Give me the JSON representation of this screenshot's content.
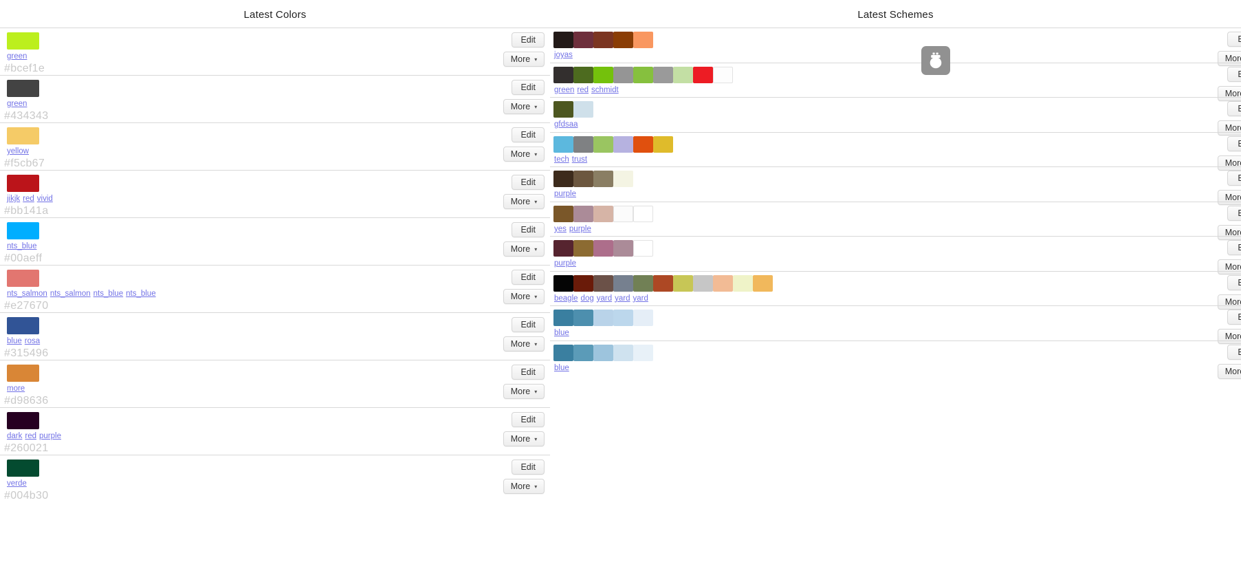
{
  "columns": {
    "colors": {
      "title": "Latest Colors",
      "edit_label": "Edit",
      "more_label": "More",
      "caret": "▾",
      "items": [
        {
          "hex": "#bcef1e",
          "swatch": "#bcef1e",
          "tags": [
            "green"
          ]
        },
        {
          "hex": "#434343",
          "swatch": "#434343",
          "tags": [
            "green"
          ]
        },
        {
          "hex": "#f5cb67",
          "swatch": "#f5cb67",
          "tags": [
            "yellow"
          ]
        },
        {
          "hex": "#bb141a",
          "swatch": "#bb141a",
          "tags": [
            "jikjk",
            "red",
            "vivid"
          ]
        },
        {
          "hex": "#00aeff",
          "swatch": "#00aeff",
          "tags": [
            "nts_blue"
          ]
        },
        {
          "hex": "#e27670",
          "swatch": "#e27670",
          "tags": [
            "nts_salmon",
            "nts_salmon",
            "nts_blue",
            "nts_blue"
          ]
        },
        {
          "hex": "#315496",
          "swatch": "#315496",
          "tags": [
            "blue",
            "rosa"
          ]
        },
        {
          "hex": "#d98636",
          "swatch": "#d98636",
          "tags": [
            "more"
          ]
        },
        {
          "hex": "#260021",
          "swatch": "#260021",
          "tags": [
            "dark",
            "red",
            "purple"
          ]
        },
        {
          "hex": "#004b30",
          "swatch": "#044b30",
          "tags": [
            "verde"
          ]
        }
      ]
    },
    "schemes": {
      "title": "Latest Schemes",
      "edit_label": "Ed",
      "more_label": "More",
      "caret": "▾",
      "items": [
        {
          "tags": [
            "joyas"
          ],
          "swatches": [
            "#231a18",
            "#6e2f3c",
            "#7b3521",
            "#8a3d05",
            "#f99760"
          ]
        },
        {
          "tags": [
            "green",
            "red",
            "schmidt"
          ],
          "swatches": [
            "#332f2e",
            "#4d6b1f",
            "#74c10c",
            "#959595",
            "#86c03e",
            "#9a9a9a",
            "#c3dfa4",
            "#ed1c24",
            "#fdfdfd"
          ]
        },
        {
          "tags": [
            "gfdsaa"
          ],
          "swatches": [
            "#4d5720",
            "#cfe0ea"
          ]
        },
        {
          "tags": [
            "tech",
            "trust"
          ],
          "swatches": [
            "#5cb8de",
            "#7f8183",
            "#9ac561",
            "#b6b2e0",
            "#e0500e",
            "#dfbb2b"
          ]
        },
        {
          "tags": [
            "purple"
          ],
          "swatches": [
            "#3d2b1c",
            "#6c573f",
            "#8a7e63",
            "#f4f4e3"
          ]
        },
        {
          "tags": [
            "yes",
            "purple"
          ],
          "swatches": [
            "#7a5729",
            "#ab8b98",
            "#d6b4a6",
            "#fbfbfb",
            "#ffffff"
          ]
        },
        {
          "tags": [
            "purple"
          ],
          "swatches": [
            "#56242f",
            "#8c6b32",
            "#ad6e8b",
            "#ab8b98",
            "#ffffff"
          ]
        },
        {
          "tags": [
            "beagle",
            "dog",
            "yard",
            "yard",
            "yard"
          ],
          "swatches": [
            "#050505",
            "#6a1b09",
            "#6b5148",
            "#76808f",
            "#718055",
            "#ad4824",
            "#c7c656",
            "#c6c6c6",
            "#f2bb95",
            "#eff3c8",
            "#f1b85c"
          ]
        },
        {
          "tags": [
            "blue"
          ],
          "swatches": [
            "#3a7fa0",
            "#4d8fae",
            "#b9d3e9",
            "#bcd7ec",
            "#e5eef7"
          ]
        },
        {
          "tags": [
            "blue"
          ],
          "swatches": [
            "#3a7fa0",
            "#5b9bb8",
            "#9dc4dd",
            "#cfe2ef",
            "#e8f1f8"
          ]
        }
      ]
    }
  },
  "overlay": {
    "icon": "usb-drive-icon",
    "background": "#919191"
  }
}
